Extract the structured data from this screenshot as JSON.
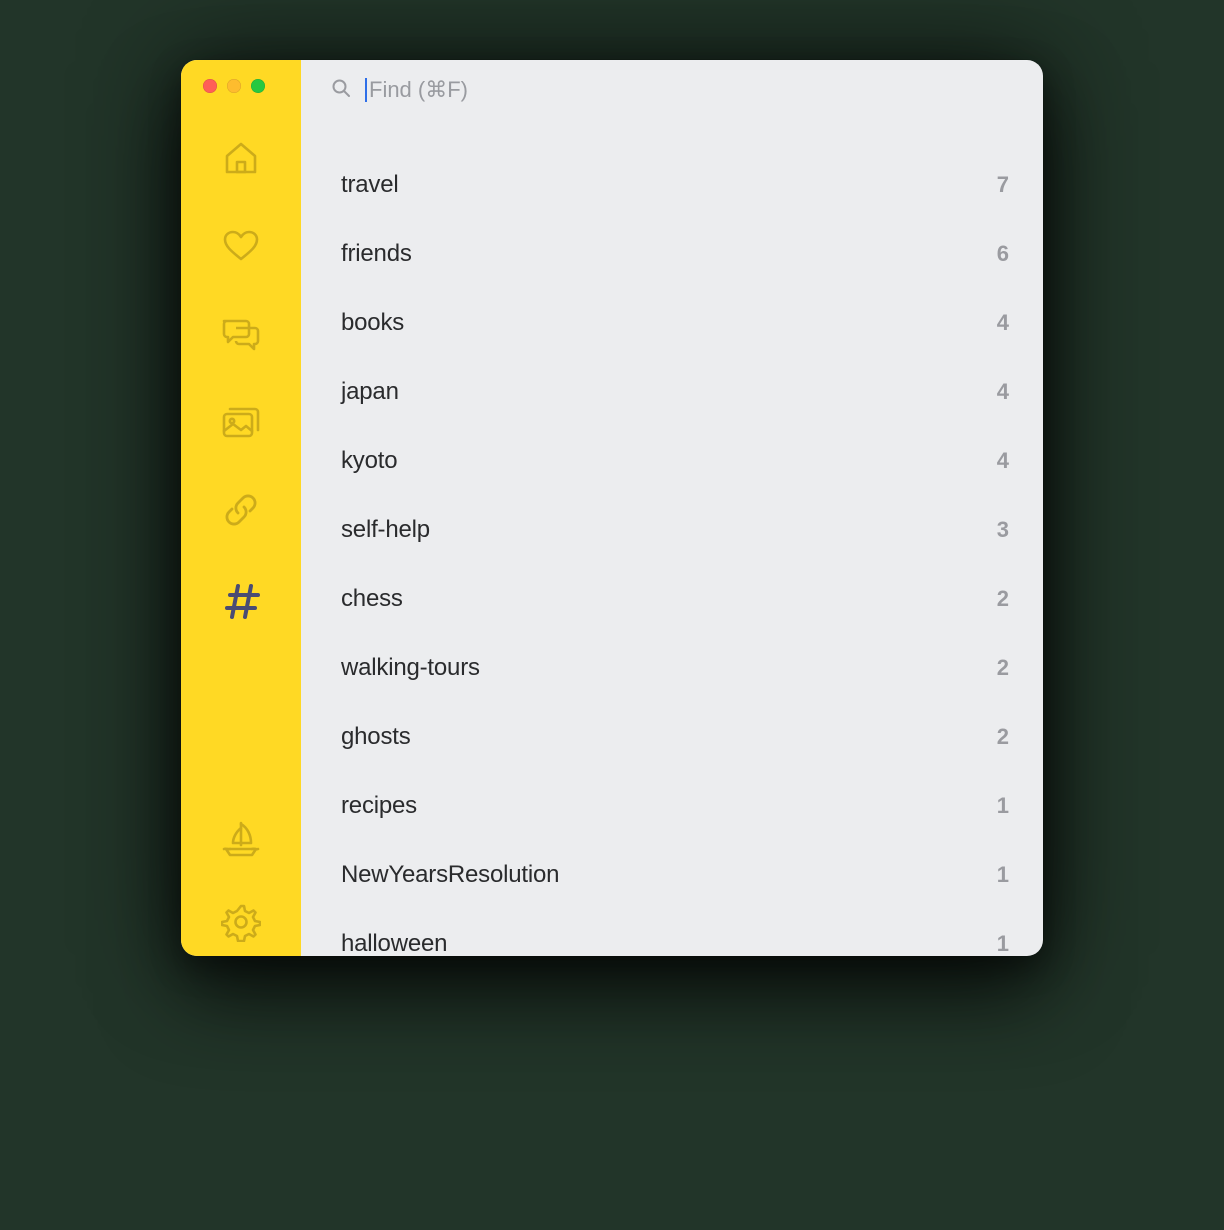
{
  "search": {
    "placeholder": "Find (⌘F)"
  },
  "tags": [
    {
      "label": "travel",
      "count": "7"
    },
    {
      "label": "friends",
      "count": "6"
    },
    {
      "label": "books",
      "count": "4"
    },
    {
      "label": "japan",
      "count": "4"
    },
    {
      "label": "kyoto",
      "count": "4"
    },
    {
      "label": "self-help",
      "count": "3"
    },
    {
      "label": "chess",
      "count": "2"
    },
    {
      "label": "walking-tours",
      "count": "2"
    },
    {
      "label": "ghosts",
      "count": "2"
    },
    {
      "label": "recipes",
      "count": "1"
    },
    {
      "label": "NewYearsResolution",
      "count": "1"
    },
    {
      "label": "halloween",
      "count": "1"
    }
  ]
}
